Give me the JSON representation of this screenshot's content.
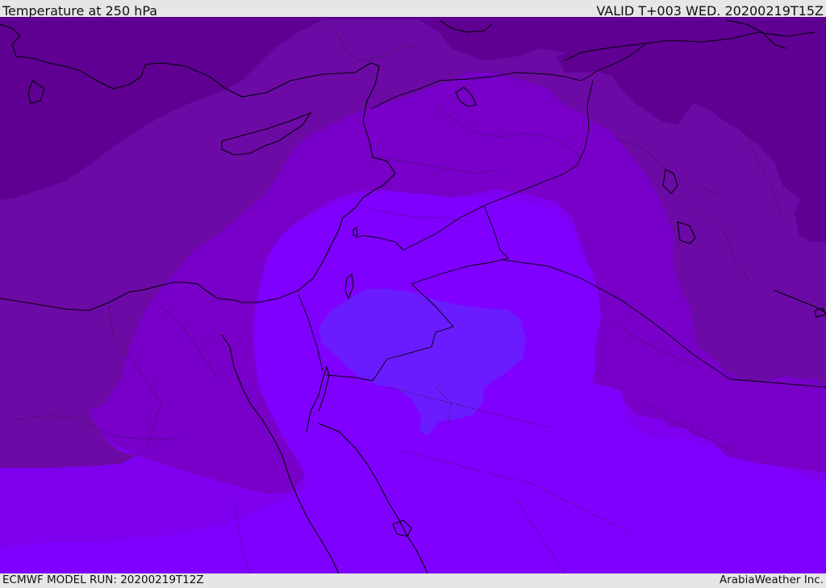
{
  "header": {
    "title": "Temperature at 250 hPa",
    "valid_time": "VALID T+003 WED. 20200219T15Z"
  },
  "footer": {
    "model_run": "ECMWF MODEL RUN: 20200219T12Z",
    "credit": "ArabiaWeather Inc."
  },
  "map": {
    "region": "Eastern Mediterranean and Middle East",
    "variable": "temperature",
    "pressure_level_hpa": 250,
    "shading_colors": {
      "band_1_darkest": "#5f0093",
      "band_2": "#6c0aa6",
      "band_3": "#7800c8",
      "band_4": "#7f00ee",
      "band_5": "#8000ff",
      "band_6_core": "#6a1cff"
    },
    "coastline_color": "#000000",
    "boundary_style": "dotted"
  }
}
